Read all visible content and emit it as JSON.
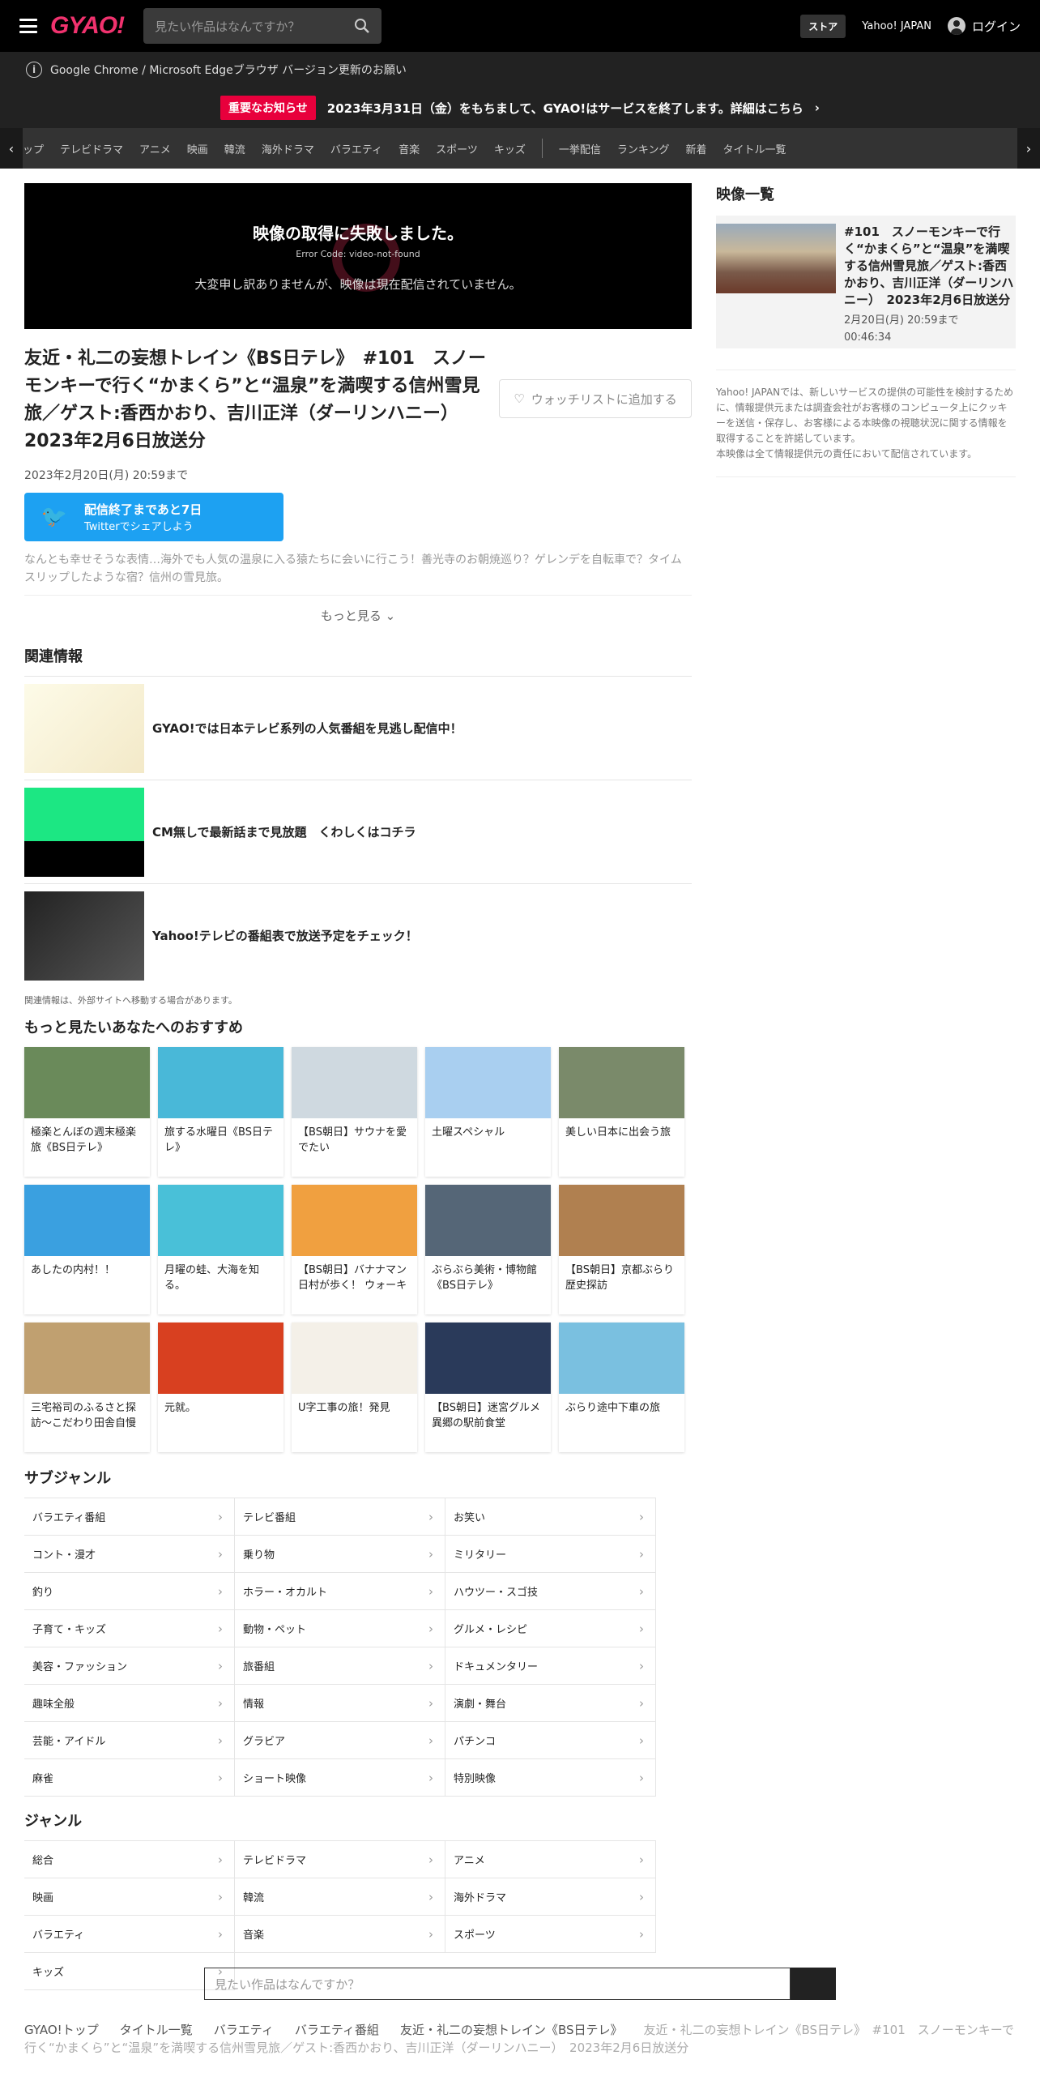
{
  "header": {
    "logo": "GYAO!",
    "search_placeholder": "見たい作品はなんですか？",
    "store": "ストア",
    "yahoo": "Yahoo! JAPAN",
    "login": "ログイン"
  },
  "browser_notice": "Google Chrome / Microsoft Edgeブラウザ バージョン更新のお願い",
  "notice": {
    "badge": "重要なお知らせ",
    "text": "2023年3月31日（金）をもちまして、GYAO!はサービスを終了します。詳細はこちら"
  },
  "category_nav": [
    "ップ",
    "テレビドラマ",
    "アニメ",
    "映画",
    "韓流",
    "海外ドラマ",
    "バラエティ",
    "音楽",
    "スポーツ",
    "キッズ",
    "一挙配信",
    "ランキング",
    "新着",
    "タイトル一覧"
  ],
  "player": {
    "error_title": "映像の取得に失敗しました。",
    "error_code": "Error Code: video-not-found",
    "message": "大変申し訳ありませんが、映像は現在配信されていません。"
  },
  "episode": {
    "title": "友近・礼二の妄想トレイン《BS日テレ》　#101　スノーモンキーで行く“かまくら”と“温泉”を満喫する信州雪見旅／ゲスト:香西かおり、吉川正洋（ダーリンハニー）　2023年2月6日放送分",
    "watchlist": "ウォッチリストに追加する",
    "available_until": "2023年2月20日(月) 20:59まで",
    "twitter_main": "配信終了まであと7日",
    "twitter_sub": "Twitterでシェアしよう",
    "description": "なんとも幸せそうな表情…海外でも人気の温泉に入る猿たちに会いに行こう！善光寺のお朝焼巡り？ゲレンデを自転車で？タイムスリップしたような宿？信州の雪見旅。",
    "more": "もっと見る"
  },
  "related": {
    "heading": "関連情報",
    "items": [
      "GYAO!では日本テレビ系列の人気番組を見逃し配信中！",
      "CM無しで最新話まで見放題　くわしくはコチラ",
      "Yahoo!テレビの番組表で放送予定をチェック！"
    ],
    "note": "関連情報は、外部サイトへ移動する場合があります。"
  },
  "recommend": {
    "heading": "もっと見たいあなたへのおすすめ",
    "items": [
      "極楽とんぼの週末極楽旅《BS日テレ》",
      "旅する水曜日《BS日テレ》",
      "【BS朝日】サウナを愛でたい",
      "土曜スペシャル",
      "美しい日本に出会う旅",
      "あしたの内村！！",
      "月曜の蛙、大海を知る。",
      "【BS朝日】バナナマン日村が歩く！ ウォーキ",
      "ぶらぶら美術・博物館《BS日テレ》",
      "【BS朝日】京都ぶらり歴史探訪",
      "三宅裕司のふるさと探訪～こだわり田舎自慢",
      "元就。",
      "U字工事の旅！発見",
      "【BS朝日】迷宮グルメ異郷の駅前食堂",
      "ぶらり途中下車の旅"
    ]
  },
  "subgenre": {
    "heading": "サブジャンル",
    "items": [
      "バラエティ番組",
      "テレビ番組",
      "お笑い",
      "コント・漫才",
      "乗り物",
      "ミリタリー",
      "釣り",
      "ホラー・オカルト",
      "ハウツー・スゴ技",
      "子育て・キッズ",
      "動物・ペット",
      "グルメ・レシピ",
      "美容・ファッション",
      "旅番組",
      "ドキュメンタリー",
      "趣味全般",
      "情報",
      "演劇・舞台",
      "芸能・アイドル",
      "グラビア",
      "パチンコ",
      "麻雀",
      "ショート映像",
      "特別映像"
    ]
  },
  "genre": {
    "heading": "ジャンル",
    "items": [
      "総合",
      "テレビドラマ",
      "アニメ",
      "映画",
      "韓流",
      "海外ドラマ",
      "バラエティ",
      "音楽",
      "スポーツ",
      "キッズ"
    ]
  },
  "sidebar": {
    "heading": "映像一覧",
    "item_title": "#101　スノーモンキーで行く“かまくら”と“温泉”を満喫する信州雪見旅／ゲスト:香西かおり、吉川正洋（ダーリンハニー）　2023年2月6日放送分",
    "item_until": "2月20日(月) 20:59まで",
    "item_duration": "00:46:34",
    "legal": "Yahoo! JAPANでは、新しいサービスの提供の可能性を検討するために、情報提供元または調査会社がお客様のコンピュータ上にクッキーを送信・保存し、お客様による本映像の視聴状況に関する情報を取得することを許諾しています。\n本映像は全て情報提供元の責任において配信されています。"
  },
  "footer": {
    "search_placeholder": "見たい作品はなんですか？",
    "breadcrumb": [
      "GYAO!トップ",
      "タイトル一覧",
      "バラエティ",
      "バラエティ番組",
      "友近・礼二の妄想トレイン《BS日テレ》"
    ],
    "breadcrumb_current": "友近・礼二の妄想トレイン《BS日テレ》　#101　スノーモンキーで行く“かまくら”と“温泉”を満喫する信州雪見旅／ゲスト:香西かおり、吉川正洋（ダーリンハニー）　2023年2月6日放送分"
  },
  "colors": {
    "brand": "#f0326e",
    "notice_badge": "#e8003c",
    "twitter": "#1da1f2"
  }
}
